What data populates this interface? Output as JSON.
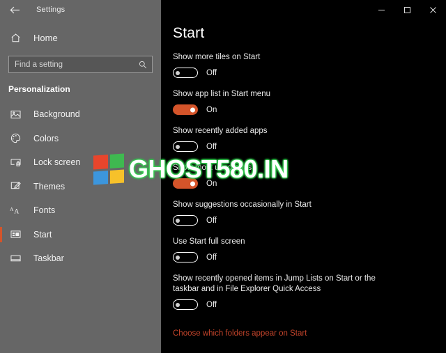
{
  "window": {
    "app_title": "Settings",
    "back_icon": "back-arrow-icon",
    "controls": {
      "minimize": "minimize-icon",
      "maximize": "maximize-icon",
      "close": "close-icon"
    }
  },
  "sidebar": {
    "home_label": "Home",
    "home_icon": "home-icon",
    "search": {
      "placeholder": "Find a setting",
      "value": "",
      "icon": "search-icon"
    },
    "section_title": "Personalization",
    "items": [
      {
        "label": "Background",
        "icon": "image-icon",
        "selected": false
      },
      {
        "label": "Colors",
        "icon": "palette-icon",
        "selected": false
      },
      {
        "label": "Lock screen",
        "icon": "lock-screen-icon",
        "selected": false
      },
      {
        "label": "Themes",
        "icon": "brush-icon",
        "selected": false
      },
      {
        "label": "Fonts",
        "icon": "fonts-aa-icon",
        "selected": false
      },
      {
        "label": "Start",
        "icon": "start-tiles-icon",
        "selected": true
      },
      {
        "label": "Taskbar",
        "icon": "taskbar-icon",
        "selected": false
      }
    ]
  },
  "main": {
    "page_title": "Start",
    "settings": [
      {
        "label": "Show more tiles on Start",
        "state": "Off",
        "on": false
      },
      {
        "label": "Show app list in Start menu",
        "state": "On",
        "on": true
      },
      {
        "label": "Show recently added apps",
        "state": "Off",
        "on": false
      },
      {
        "label": "Show most used apps",
        "state": "On",
        "on": true
      },
      {
        "label": "Show suggestions occasionally in Start",
        "state": "Off",
        "on": false
      },
      {
        "label": "Use Start full screen",
        "state": "Off",
        "on": false
      },
      {
        "label": "Show recently opened items in Jump Lists on Start or the taskbar and in File Explorer Quick Access",
        "state": "Off",
        "on": false
      }
    ],
    "link_label": "Choose which folders appear on Start"
  },
  "watermark": {
    "text": "GHOST580.IN",
    "logo": "windows-logo-icon",
    "logo_colors": [
      "#e8452c",
      "#3fb950",
      "#3c96dd",
      "#f7c12a"
    ]
  },
  "colors": {
    "accent": "#d4542a",
    "sidebar_bg": "#666666",
    "content_bg": "#000000",
    "link": "#c1432a",
    "watermark_glow": "#35c94f"
  }
}
